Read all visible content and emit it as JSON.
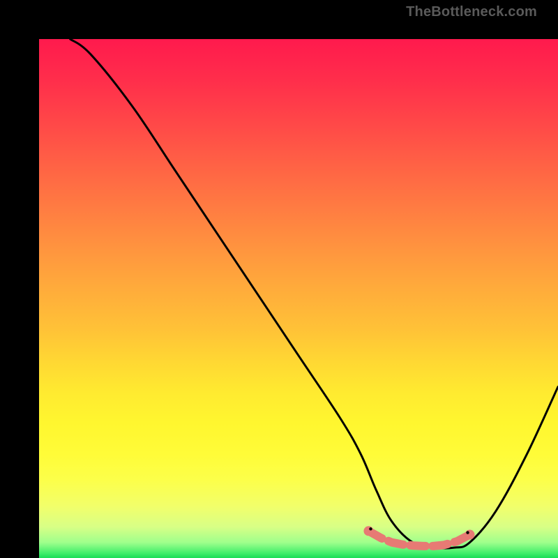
{
  "watermark": "TheBottleneck.com",
  "chart_data": {
    "type": "line",
    "title": "",
    "xlabel": "",
    "ylabel": "",
    "xlim": [
      0,
      100
    ],
    "ylim": [
      0,
      100
    ],
    "series": [
      {
        "name": "curve",
        "x": [
          6,
          10,
          18,
          26,
          34,
          42,
          50,
          58,
          62,
          65,
          68,
          72,
          76,
          80,
          83,
          88,
          94,
          100
        ],
        "values": [
          100,
          97,
          87,
          75,
          63,
          51,
          39,
          27,
          20,
          13,
          7,
          3,
          2,
          2,
          3,
          9,
          20,
          33
        ]
      }
    ],
    "highlight_band": {
      "name": "bottom-markers",
      "x": [
        63.5,
        66,
        68,
        70,
        72,
        74,
        76,
        78,
        80.5,
        83
      ],
      "values": [
        5.2,
        3.8,
        3.0,
        2.6,
        2.4,
        2.3,
        2.3,
        2.5,
        3.2,
        4.5
      ]
    },
    "gradient_stops": [
      {
        "pos": 0,
        "color": "#ff1a4d"
      },
      {
        "pos": 50,
        "color": "#ffc237"
      },
      {
        "pos": 80,
        "color": "#fffc38"
      },
      {
        "pos": 100,
        "color": "#18dc57"
      }
    ]
  }
}
